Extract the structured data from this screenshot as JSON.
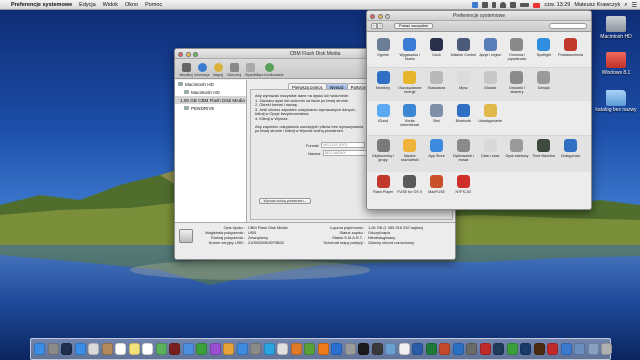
{
  "menubar": {
    "app": "Preferencje systemowe",
    "items": [
      "Edycja",
      "Widok",
      "Okno",
      "Pomoc"
    ],
    "clock": "czw. 13:29",
    "user": "Mateusz Krawczyk"
  },
  "desktop_icons": [
    {
      "label": "Macintosh HD",
      "icon": "hard-drive-icon",
      "color": "#9aa3ad"
    },
    {
      "label": "Windows 8.1",
      "icon": "windows-drive-icon",
      "color": "#e8423a"
    },
    {
      "label": "katalog bez nazwy",
      "icon": "folder-icon",
      "color": "#7fb6e8"
    }
  ],
  "disk_utility": {
    "title": "CBM Flash Disk Media",
    "toolbar": [
      "Weryfikuj",
      "Informacje",
      "Nagraj",
      "Odmontuj",
      "Wysuń",
      "Włącz kronikowanie",
      "Nowy obraz",
      "Konwertuj",
      "Zmień rozmiar obrazu",
      "Dziennik"
    ],
    "sidebar": [
      {
        "label": "Macintosh HD",
        "level": 0
      },
      {
        "label": "Macintosh HD",
        "level": 1
      },
      {
        "label": "1,06 GB CBM Flash Disk Media",
        "level": 0,
        "selected": true
      },
      {
        "label": "PENDRIVE",
        "level": 1
      }
    ],
    "tabs": [
      "Pierwsza pomoc",
      "Wymaż",
      "Partycje"
    ],
    "active_tab": "Wymaż",
    "instructions": [
      "Aby wymazać wszystkie dane na dysku lub woluminie:",
      "1.   Zaznacz dysk lub wolumin na liście po lewej stronie.",
      "2.   Określ format i nazwę.",
      "3.   Jeśli chcesz zapobiec odzyskaniu wymazanych danych,",
      "       kliknij w Opcje bezpieczeństwa.",
      "4.   Kliknij w Wymaż.",
      "Aby zapobiec odzyskaniu usuniętych plików bez wymazywania",
      "po lewej stronie i kliknij w Wymaż wolną przestrzeń."
    ],
    "format_label": "Format:",
    "format_value": "MS-DOS (FAT)",
    "name_label": "Nazwa:",
    "name_value": "BEZ NAZWY",
    "btn_erase_free": "Wymaż wolną przestrzeń...",
    "btn_security": "Opcje bezpieczeństwa...",
    "info": {
      "left_labels": [
        "Opis dysku :",
        "Magistrala połączenia :",
        "Rodzaj połączenia :",
        "Numer seryjny USB :"
      ],
      "left_values": [
        "CBM Flash Disk Media",
        "USB",
        "Zewnętrzny",
        "2109520080DF3B02"
      ],
      "right_labels": [
        "Łączna pojemność :",
        "Status zapisu :",
        "Status S.M.A.R.T. :",
        "Schemat mapy partycji :"
      ],
      "right_values": [
        "1,06 GB (1 055 916 032 bajtów)",
        "Odczyt/zapis",
        "Nieobsługiwany",
        "Główny rekord rozruchowy"
      ]
    }
  },
  "sysprefs": {
    "title": "Preferencje systemowe",
    "show_all": "Pokaż wszystkie",
    "rows": [
      [
        {
          "label": "Ogólne",
          "icon": "general-icon",
          "color": "#6b7e96"
        },
        {
          "label": "Wygaszacz i biurko",
          "icon": "desktop-icon",
          "color": "#3a7bd5"
        },
        {
          "label": "Dock",
          "icon": "dock-icon",
          "color": "#2a2f4a"
        },
        {
          "label": "Mission Control",
          "icon": "mission-control-icon",
          "color": "#4a5a78"
        },
        {
          "label": "Język i region",
          "icon": "language-icon",
          "color": "#5a7fb8"
        },
        {
          "label": "Ochrona i prywatność",
          "icon": "security-icon",
          "color": "#8a8a8a"
        },
        {
          "label": "Spotlight",
          "icon": "spotlight-icon",
          "color": "#2f8ee0"
        },
        {
          "label": "Powiadomienia",
          "icon": "notifications-icon",
          "color": "#c0392b"
        }
      ],
      [
        {
          "label": "Monitory",
          "icon": "displays-icon",
          "color": "#2f6fc4"
        },
        {
          "label": "Oszczędzanie energii",
          "icon": "energy-icon",
          "color": "#e8b62c"
        },
        {
          "label": "Klawiatura",
          "icon": "keyboard-icon",
          "color": "#b9b9b9"
        },
        {
          "label": "Mysz",
          "icon": "mouse-icon",
          "color": "#dcdcdc"
        },
        {
          "label": "Gładzik",
          "icon": "trackpad-icon",
          "color": "#c8c8c8"
        },
        {
          "label": "Drukarki i skanery",
          "icon": "printer-icon",
          "color": "#8b8b8b"
        },
        {
          "label": "Dźwięk",
          "icon": "sound-icon",
          "color": "#9a9a9a"
        }
      ],
      [
        {
          "label": "iCloud",
          "icon": "icloud-icon",
          "color": "#5aa9f2"
        },
        {
          "label": "Konta internetowe",
          "icon": "internet-accounts-icon",
          "color": "#3d86d4"
        },
        {
          "label": "Sieć",
          "icon": "network-icon",
          "color": "#7f8fa8"
        },
        {
          "label": "Bluetooth",
          "icon": "bluetooth-icon",
          "color": "#2f6fc4"
        },
        {
          "label": "Udostępnianie",
          "icon": "sharing-icon",
          "color": "#e0b94a"
        }
      ],
      [
        {
          "label": "Użytkownicy i grupy",
          "icon": "users-icon",
          "color": "#7a7a7a"
        },
        {
          "label": "Nadzór rodzicielski",
          "icon": "parental-icon",
          "color": "#f0b33a"
        },
        {
          "label": "App Store",
          "icon": "app-store-icon",
          "color": "#3d8be0"
        },
        {
          "label": "Dyktowanie i mowa",
          "icon": "dictation-icon",
          "color": "#8a8a8a"
        },
        {
          "label": "Data i czas",
          "icon": "date-time-icon",
          "color": "#d9d9d9"
        },
        {
          "label": "Dysk startowy",
          "icon": "startup-disk-icon",
          "color": "#9a9a9a"
        },
        {
          "label": "Time Machine",
          "icon": "time-machine-icon",
          "color": "#3d4a3d"
        },
        {
          "label": "Dostępność",
          "icon": "accessibility-icon",
          "color": "#2f6fc4"
        }
      ],
      [
        {
          "label": "Flash Player",
          "icon": "flash-icon",
          "color": "#c0392b"
        },
        {
          "label": "FUSE for OS X",
          "icon": "fuse-icon",
          "color": "#5a5a5a"
        },
        {
          "label": "MacFUSE",
          "icon": "macfuse-icon",
          "color": "#c8502a"
        },
        {
          "label": "NTFS-3G",
          "icon": "ntfs-icon",
          "color": "#d0302a"
        }
      ]
    ]
  },
  "dock": [
    {
      "icon": "finder-icon",
      "color": "#3a8ee6"
    },
    {
      "icon": "launchpad-icon",
      "color": "#8a8a8a"
    },
    {
      "icon": "mission-control-icon",
      "color": "#1f2f4f"
    },
    {
      "icon": "safari-icon",
      "color": "#3a8ee6"
    },
    {
      "icon": "mail-icon",
      "color": "#d9d9d9"
    },
    {
      "icon": "contacts-icon",
      "color": "#b58a5a"
    },
    {
      "icon": "calendar-icon",
      "color": "#ffffff"
    },
    {
      "icon": "notes-icon",
      "color": "#f2e07a"
    },
    {
      "icon": "reminders-icon",
      "color": "#ffffff"
    },
    {
      "icon": "maps-icon",
      "color": "#5ab05a"
    },
    {
      "icon": "photo-booth-icon",
      "color": "#7a1f1f"
    },
    {
      "icon": "messages-icon",
      "color": "#4a8fe0"
    },
    {
      "icon": "facetime-icon",
      "color": "#3aa03a"
    },
    {
      "icon": "itunes-icon",
      "color": "#9b4fd0"
    },
    {
      "icon": "ibooks-icon",
      "color": "#e8a33a"
    },
    {
      "icon": "app-store-icon",
      "color": "#3d8be0"
    },
    {
      "icon": "system-preferences-icon",
      "color": "#8a8a8a"
    },
    {
      "icon": "skype-icon",
      "color": "#2aa4e0"
    },
    {
      "icon": "chrome-icon",
      "color": "#e0e0e0"
    },
    {
      "icon": "firefox-icon",
      "color": "#e07a2a"
    },
    {
      "icon": "utorrent-icon",
      "color": "#5aa03a"
    },
    {
      "icon": "vlc-icon",
      "color": "#f07a1a"
    },
    {
      "icon": "teamviewer-icon",
      "color": "#2a6fd0"
    },
    {
      "icon": "disk-utility-icon",
      "color": "#9a9a9a"
    },
    {
      "icon": "terminal-icon",
      "color": "#1a1a1a"
    },
    {
      "icon": "activity-monitor-icon",
      "color": "#3a3a3a"
    },
    {
      "icon": "preview-icon",
      "color": "#6a9fd0"
    },
    {
      "icon": "textedit-icon",
      "color": "#f0f0f0"
    },
    {
      "icon": "word-icon",
      "color": "#2a5caa"
    },
    {
      "icon": "excel-icon",
      "color": "#1f7a3a"
    },
    {
      "icon": "powerpoint-icon",
      "color": "#c44a2a"
    },
    {
      "icon": "outlook-icon",
      "color": "#2a6fc4"
    },
    {
      "icon": "vmware-icon",
      "color": "#6a6a6a"
    },
    {
      "icon": "parallels-icon",
      "color": "#c02a2a"
    },
    {
      "icon": "steam-icon",
      "color": "#1f3a5a"
    },
    {
      "icon": "spotify-icon",
      "color": "#3aa03a"
    },
    {
      "icon": "photoshop-icon",
      "color": "#1a3a6a"
    },
    {
      "icon": "illustrator-icon",
      "color": "#4a2a10"
    },
    {
      "icon": "transmission-icon",
      "color": "#c02a2a"
    },
    {
      "icon": "xcode-icon",
      "color": "#3a7ad0"
    },
    {
      "icon": "downloads-icon",
      "color": "#6a8fc0"
    },
    {
      "icon": "documents-icon",
      "color": "#8aa0c0"
    },
    {
      "icon": "trash-icon",
      "color": "#b0b0b0"
    }
  ]
}
